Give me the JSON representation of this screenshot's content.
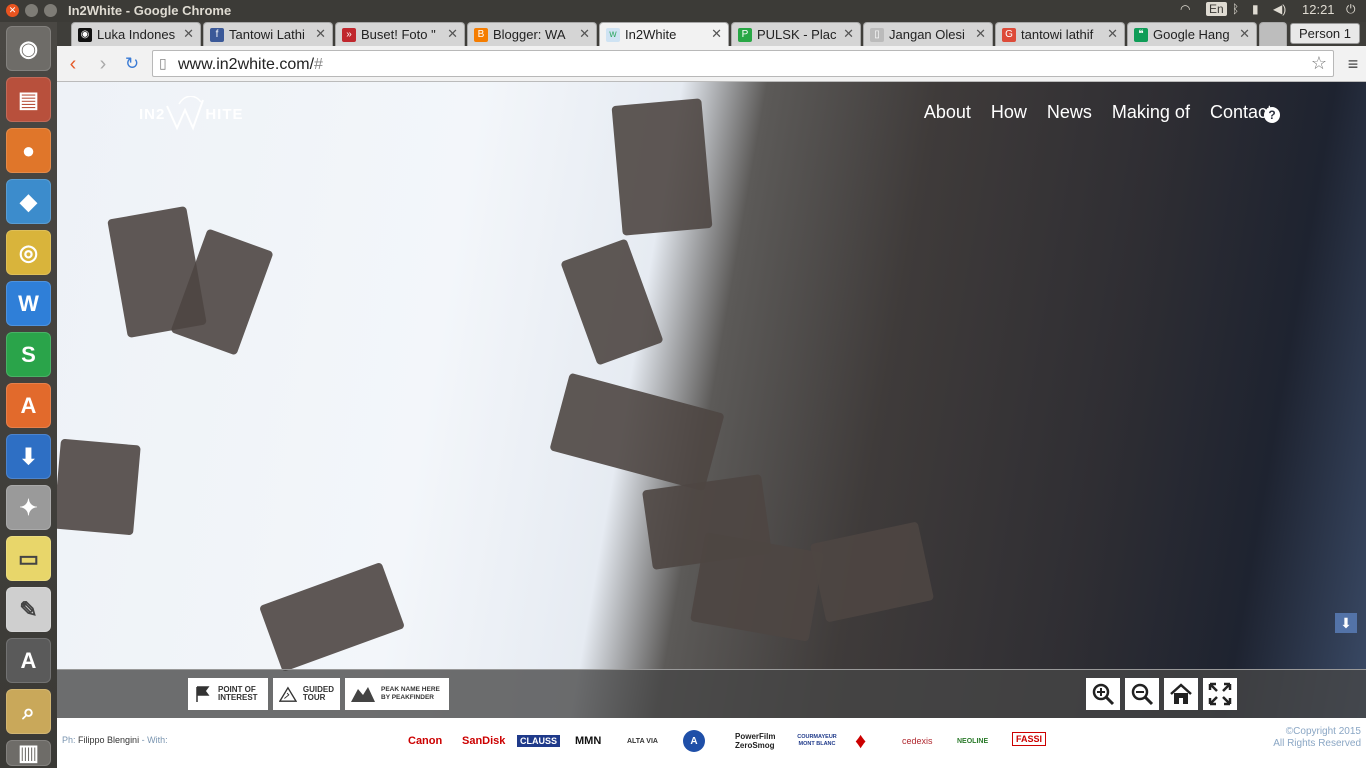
{
  "os": {
    "window_title": "In2White - Google Chrome",
    "keyboard_layout": "En",
    "clock": "12:21"
  },
  "launcher": {
    "items": [
      "dash-icon",
      "files-icon",
      "firefox-icon",
      "box-icon",
      "chrome-icon",
      "writer-icon",
      "spreadsheet-icon",
      "software-center-icon",
      "download-icon",
      "settings-icon",
      "sticky-notes-icon",
      "text-editor-icon",
      "updater-icon",
      "image-viewer-icon",
      "trash-icon"
    ]
  },
  "browser": {
    "tabs": [
      {
        "label": "Luka Indones",
        "favicon_color": "#111"
      },
      {
        "label": "Tantowi Lathi",
        "favicon_color": "#3b5998"
      },
      {
        "label": "Buset! Foto \"",
        "favicon_color": "#c0272d"
      },
      {
        "label": "Blogger: WA",
        "favicon_color": "#f57d00"
      },
      {
        "label": "In2White",
        "favicon_color": "#cfe3f3"
      },
      {
        "label": "PULSK - Plac",
        "favicon_color": "#28a745"
      },
      {
        "label": "Jangan Olesi",
        "favicon_color": "#bbbbbb"
      },
      {
        "label": "tantowi lathif",
        "favicon_color": "#dd4b39"
      },
      {
        "label": "Google Hang",
        "favicon_color": "#0f9d58"
      }
    ],
    "person_label": "Person 1",
    "url_host": "www.in2white.com/",
    "url_hash": "#"
  },
  "site": {
    "logo_text_left": "IN2",
    "logo_text_right": "HITE",
    "nav": [
      "About",
      "How",
      "News",
      "Making of",
      "Contact"
    ],
    "help_label": "?",
    "modes": [
      {
        "label": "POINT OF\nINTEREST",
        "icon": "flag-icon"
      },
      {
        "label": "GUIDED\nTOUR",
        "icon": "mountain-path-icon"
      },
      {
        "label": "PEAK NAME HERE\nby PeakFinder",
        "icon": "peak-icon"
      }
    ],
    "map_controls": [
      "zoom-in-icon",
      "zoom-out-icon",
      "home-icon",
      "fullscreen-icon"
    ],
    "credit_prefix": "Ph:",
    "credit_name": "Filippo Blengini",
    "credit_with": "- With:",
    "sponsors": [
      {
        "name": "Canon",
        "color": "#cc0000"
      },
      {
        "name": "SanDisk",
        "color": "#cc0000"
      },
      {
        "name": "CLAUSS",
        "color": "#1f3a8a"
      },
      {
        "name": "MMN",
        "color": "#111111"
      },
      {
        "name": "ALTA VIA",
        "color": "#333333"
      },
      {
        "name": "A",
        "color": "#1f4fa8"
      },
      {
        "name": "PowerFilm ZeroSmog",
        "color": "#222222"
      },
      {
        "name": "COURMAYEUR MONT BLANC",
        "color": "#1f3a8a"
      },
      {
        "name": "♦",
        "color": "#cc0000"
      },
      {
        "name": "cedexis",
        "color": "#b0282f"
      },
      {
        "name": "NEOLINE",
        "color": "#2a7a2a"
      },
      {
        "name": "FASSI",
        "color": "#cc0000"
      }
    ],
    "copyright_line1": "©Copyright 2015",
    "copyright_line2": "All Rights Reserved"
  }
}
